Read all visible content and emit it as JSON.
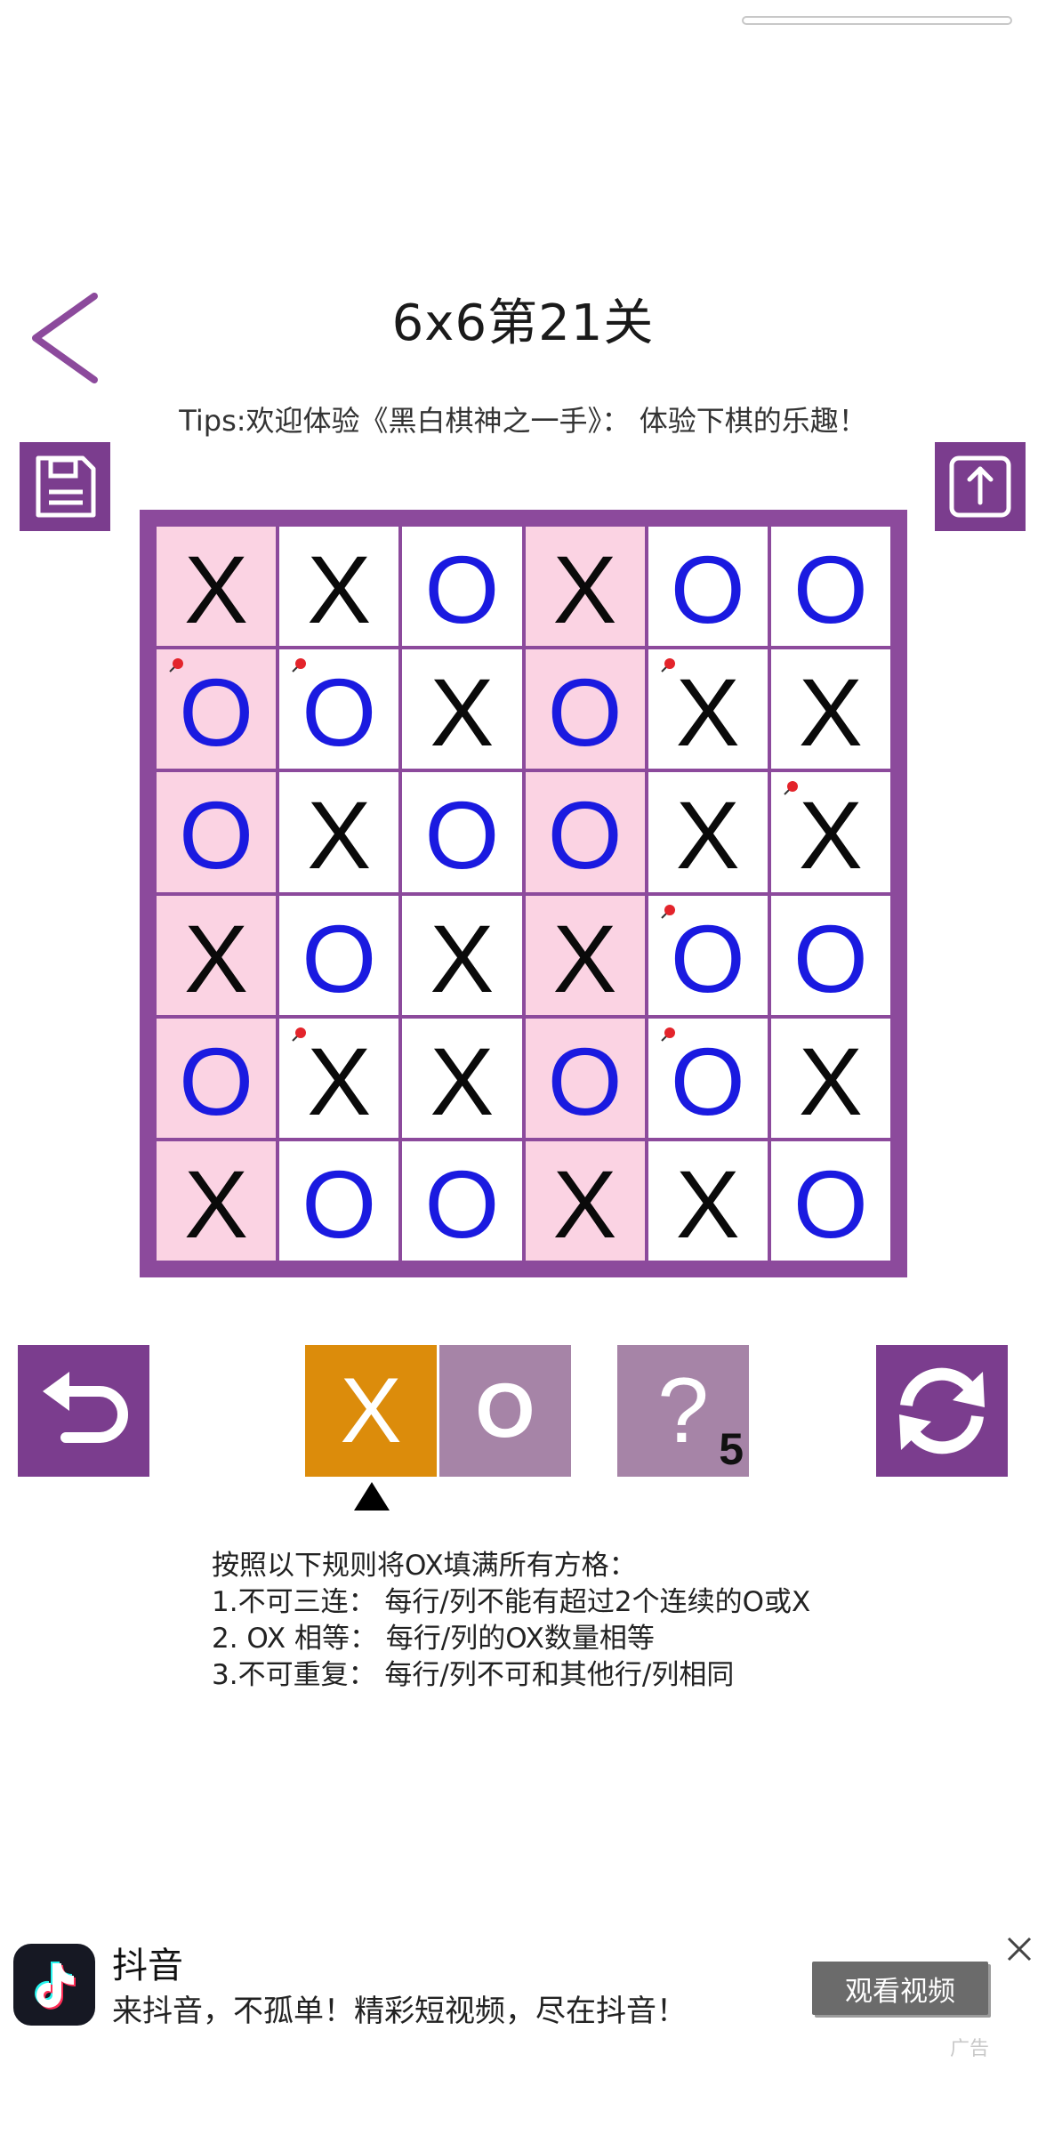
{
  "header": {
    "title": "6x6第21关",
    "tips": "Tips:欢迎体验《黑白棋神之一手》：  体验下棋的乐趣！"
  },
  "board": {
    "rows": [
      [
        {
          "v": "X",
          "pink": true,
          "pin": false
        },
        {
          "v": "X",
          "pink": false,
          "pin": false
        },
        {
          "v": "O",
          "pink": false,
          "pin": false
        },
        {
          "v": "X",
          "pink": true,
          "pin": false
        },
        {
          "v": "O",
          "pink": false,
          "pin": false
        },
        {
          "v": "O",
          "pink": false,
          "pin": false
        }
      ],
      [
        {
          "v": "O",
          "pink": true,
          "pin": true
        },
        {
          "v": "O",
          "pink": false,
          "pin": true
        },
        {
          "v": "X",
          "pink": false,
          "pin": false
        },
        {
          "v": "O",
          "pink": true,
          "pin": false
        },
        {
          "v": "X",
          "pink": false,
          "pin": true
        },
        {
          "v": "X",
          "pink": false,
          "pin": false
        }
      ],
      [
        {
          "v": "O",
          "pink": true,
          "pin": false
        },
        {
          "v": "X",
          "pink": false,
          "pin": false
        },
        {
          "v": "O",
          "pink": false,
          "pin": false
        },
        {
          "v": "O",
          "pink": true,
          "pin": false
        },
        {
          "v": "X",
          "pink": false,
          "pin": false
        },
        {
          "v": "X",
          "pink": false,
          "pin": true
        }
      ],
      [
        {
          "v": "X",
          "pink": true,
          "pin": false
        },
        {
          "v": "O",
          "pink": false,
          "pin": false
        },
        {
          "v": "X",
          "pink": false,
          "pin": false
        },
        {
          "v": "X",
          "pink": true,
          "pin": false
        },
        {
          "v": "O",
          "pink": false,
          "pin": true
        },
        {
          "v": "O",
          "pink": false,
          "pin": false
        }
      ],
      [
        {
          "v": "O",
          "pink": true,
          "pin": false
        },
        {
          "v": "X",
          "pink": false,
          "pin": true
        },
        {
          "v": "X",
          "pink": false,
          "pin": false
        },
        {
          "v": "O",
          "pink": true,
          "pin": false
        },
        {
          "v": "O",
          "pink": false,
          "pin": true
        },
        {
          "v": "X",
          "pink": false,
          "pin": false
        }
      ],
      [
        {
          "v": "X",
          "pink": true,
          "pin": false
        },
        {
          "v": "O",
          "pink": false,
          "pin": false
        },
        {
          "v": "O",
          "pink": false,
          "pin": false
        },
        {
          "v": "X",
          "pink": true,
          "pin": false
        },
        {
          "v": "X",
          "pink": false,
          "pin": false
        },
        {
          "v": "O",
          "pink": false,
          "pin": false
        }
      ]
    ]
  },
  "tools": {
    "x_label": "X",
    "o_label": "O",
    "hint_label": "?",
    "hint_count": "5",
    "selected": "X"
  },
  "rules": [
    "按照以下规则将OX填满所有方格：",
    "1.不可三连：  每行/列不能有超过2个连续的O或X",
    "2. OX 相等：  每行/列的OX数量相等",
    "3.不可重复：  每行/列不可和其他行/列相同"
  ],
  "ad": {
    "title": "抖音",
    "description": "来抖音，不孤单！精彩短视频，尽在抖音！",
    "cta": "观看视频",
    "label": "广告"
  },
  "colors": {
    "accent": "#7b3d8e",
    "board_frame": "#8c4a9c",
    "pink_cell": "#fbd3e3",
    "o_color": "#1a1ae0",
    "x_color": "#0a0a0a",
    "tool_selected": "#dc8c0b",
    "tool_idle": "#a684a7"
  },
  "icons": {
    "back": "chevron-left-icon",
    "save": "floppy-disk-icon",
    "share": "share-upload-icon",
    "undo": "undo-arrow-icon",
    "refresh": "refresh-cycle-icon",
    "pin": "red-pin-icon",
    "close": "close-icon"
  }
}
